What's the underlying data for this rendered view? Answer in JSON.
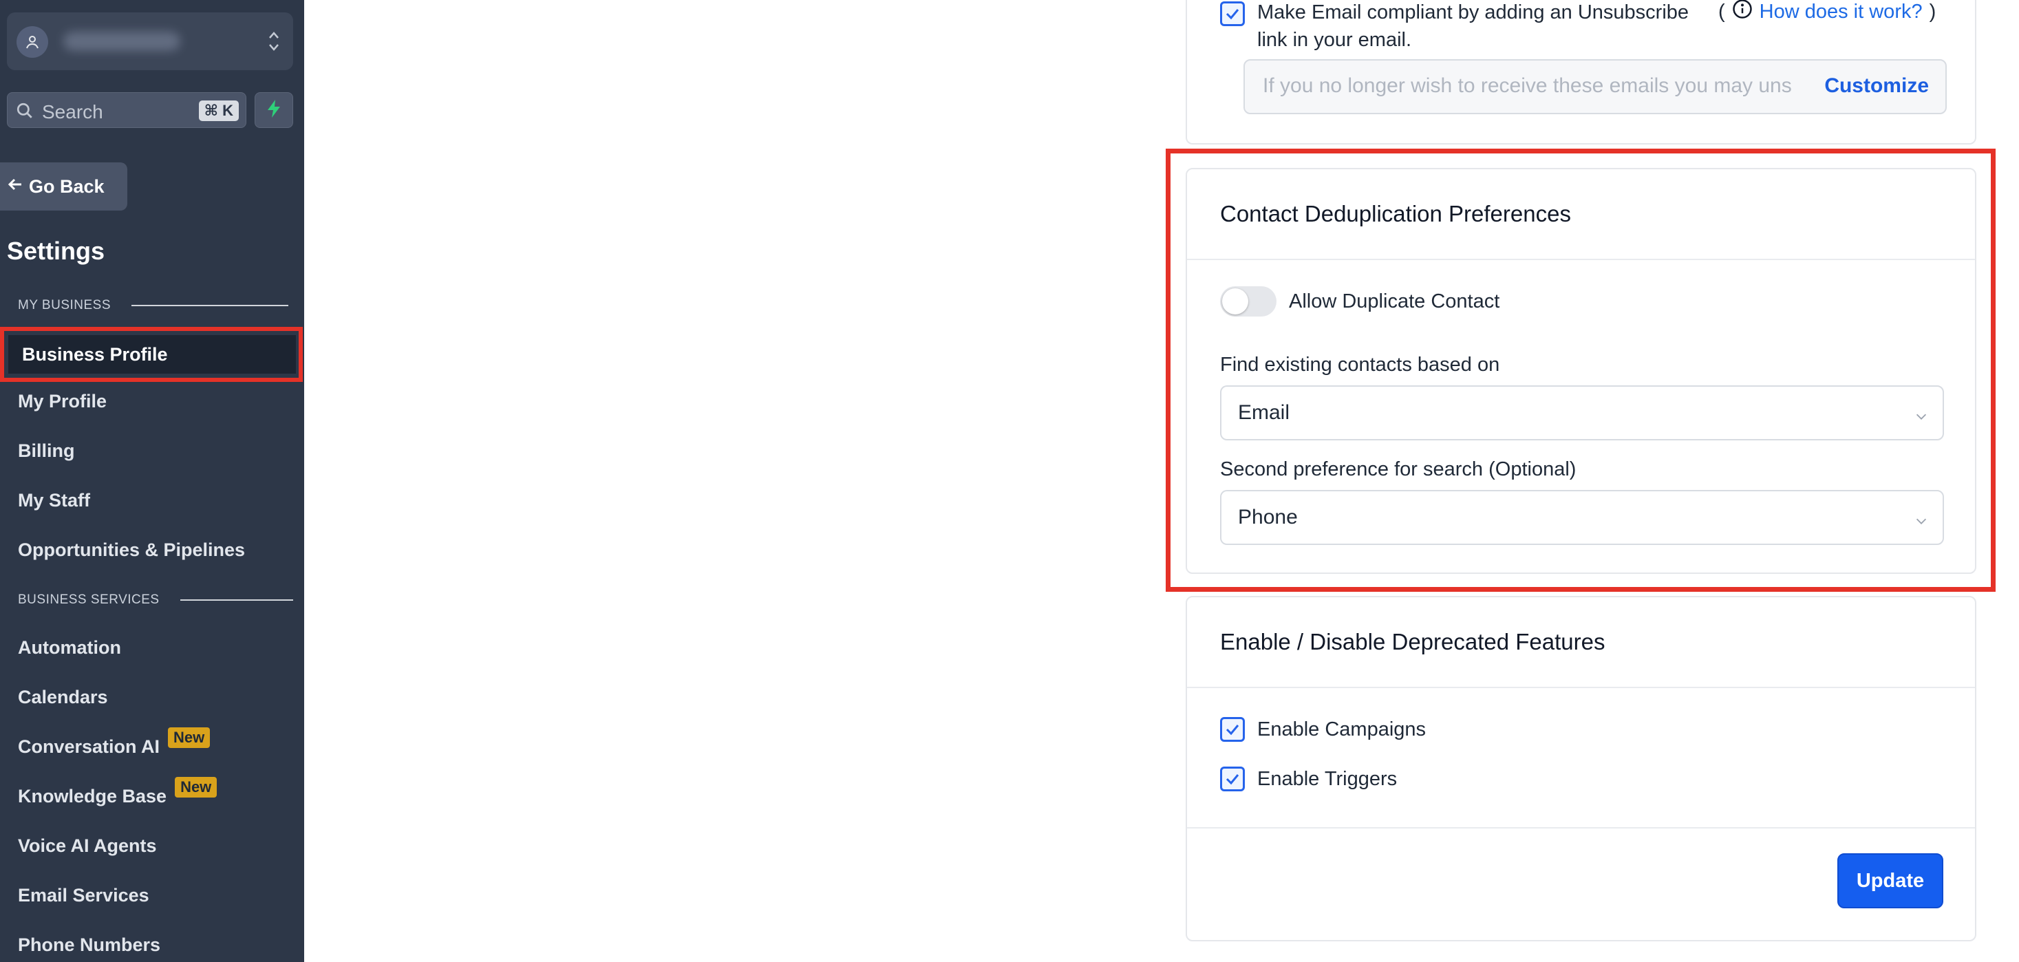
{
  "sidebar": {
    "search": {
      "placeholder": "Search",
      "shortcut": "⌘ K"
    },
    "go_back": "Go Back",
    "title": "Settings",
    "sections": {
      "my_business": "MY BUSINESS",
      "business_services": "BUSINESS SERVICES"
    },
    "items": [
      {
        "label": "Business Profile",
        "active": true
      },
      {
        "label": "My Profile"
      },
      {
        "label": "Billing"
      },
      {
        "label": "My Staff"
      },
      {
        "label": "Opportunities & Pipelines"
      },
      {
        "label": "Automation"
      },
      {
        "label": "Calendars"
      },
      {
        "label": "Conversation AI",
        "badge": "New"
      },
      {
        "label": "Knowledge Base",
        "badge": "New"
      },
      {
        "label": "Voice AI Agents"
      },
      {
        "label": "Email Services"
      },
      {
        "label": "Phone Numbers"
      }
    ]
  },
  "email_compliance": {
    "checkbox_label_line1": "Make Email compliant by adding an Unsubscribe",
    "checkbox_label_line2": "link in your email.",
    "checked": true,
    "open_paren": "(",
    "close_paren": ")",
    "help_link": "How does it work?",
    "footer_placeholder": "If you no longer wish to receive these emails you may unsubscribe",
    "customize_label": "Customize"
  },
  "dedup": {
    "title": "Contact Deduplication Preferences",
    "toggle_label": "Allow Duplicate Contact",
    "toggle_on": false,
    "find_label": "Find existing contacts based on",
    "find_value": "Email",
    "second_label": "Second preference for search (Optional)",
    "second_value": "Phone"
  },
  "deprecated": {
    "title": "Enable / Disable Deprecated Features",
    "options": [
      {
        "label": "Enable Campaigns",
        "checked": true
      },
      {
        "label": "Enable Triggers",
        "checked": true
      }
    ],
    "update_label": "Update"
  },
  "colors": {
    "sidebar_bg": "#2d3748",
    "accent_blue": "#155eef",
    "highlight_red": "#e53228",
    "badge_new": "#d9a21b"
  }
}
